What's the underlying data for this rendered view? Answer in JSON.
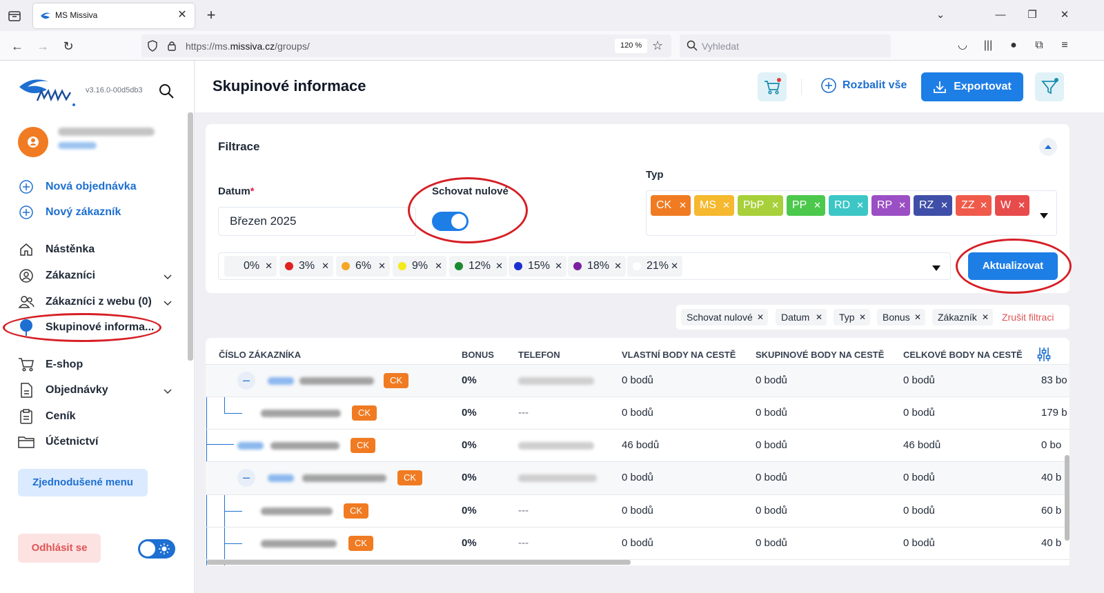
{
  "browser": {
    "tab_title": "MS Missiva",
    "url_prefix": "https://ms.",
    "url_domain": "missiva.cz",
    "url_path": "/groups/",
    "zoom": "120 %",
    "search_placeholder": "Vyhledat"
  },
  "sidebar": {
    "version": "v3.16.0-00d5db3",
    "actions": [
      {
        "label": "Nová objednávka",
        "icon": "plus-circle-icon"
      },
      {
        "label": "Nový zákazník",
        "icon": "plus-circle-icon"
      }
    ],
    "items": [
      {
        "label": "Nástěnka",
        "icon": "home-icon"
      },
      {
        "label": "Zákazníci",
        "icon": "user-circle-icon"
      },
      {
        "label": "Zákazníci z webu (0)",
        "icon": "users-icon"
      },
      {
        "label": "Skupinové informa...",
        "icon": "tree-icon"
      },
      {
        "label": "E-shop",
        "icon": "cart-icon"
      },
      {
        "label": "Objednávky",
        "icon": "document-icon"
      },
      {
        "label": "Ceník",
        "icon": "clipboard-icon"
      },
      {
        "label": "Účetnictví",
        "icon": "folder-icon"
      }
    ],
    "simple_menu": "Zjednodušené menu",
    "logout": "Odhlásit se"
  },
  "header": {
    "title": "Skupinové informace",
    "expand_all": "Rozbalit vše",
    "export": "Exportovat"
  },
  "filters": {
    "title": "Filtrace",
    "date_label": "Datum",
    "date_required": "*",
    "date_value": "Březen 2025",
    "hide_zero_label": "Schovat nulové",
    "hide_zero_on": true,
    "type_label": "Typ",
    "types": [
      {
        "label": "CK",
        "color": "#f07b22"
      },
      {
        "label": "MS",
        "color": "#f5b82e"
      },
      {
        "label": "PbP",
        "color": "#a8d03a"
      },
      {
        "label": "PP",
        "color": "#4cc84c"
      },
      {
        "label": "RD",
        "color": "#3cc6c6"
      },
      {
        "label": "RP",
        "color": "#9b4fc4"
      },
      {
        "label": "RZ",
        "color": "#3f4fa8"
      },
      {
        "label": "ZZ",
        "color": "#f05a4a"
      },
      {
        "label": "W",
        "color": "#e84b4b"
      }
    ],
    "vat_rates": [
      {
        "label": "0%",
        "color": "#f3f4f6"
      },
      {
        "label": "3%",
        "color": "#e02020"
      },
      {
        "label": "6%",
        "color": "#f5a623"
      },
      {
        "label": "9%",
        "color": "#f5e91b"
      },
      {
        "label": "12%",
        "color": "#1b8a2e"
      },
      {
        "label": "15%",
        "color": "#1b2fd1"
      },
      {
        "label": "18%",
        "color": "#7b1fa2"
      },
      {
        "label": "21%",
        "color": "#ffffff"
      }
    ],
    "update_button": "Aktualizovat"
  },
  "active_filters": {
    "chips": [
      "Schovat nulové",
      "Datum",
      "Typ",
      "Bonus",
      "Zákazník"
    ],
    "reset": "Zrušit filtraci"
  },
  "table": {
    "columns": [
      "ČÍSLO ZÁKAZNÍKA",
      "BONUS",
      "TELEFON",
      "VLASTNÍ BODY NA CESTĚ",
      "SKUPINOVÉ BODY NA CESTĚ",
      "CELKOVÉ BODY NA CESTĚ"
    ],
    "rows": [
      {
        "type": "CK",
        "bonus": "0%",
        "phone": "",
        "own": "0 bodů",
        "group": "0 bodů",
        "total": "0 bodů",
        "last": "83 bo"
      },
      {
        "type": "CK",
        "bonus": "0%",
        "phone": "---",
        "own": "0 bodů",
        "group": "0 bodů",
        "total": "0 bodů",
        "last": "179 b"
      },
      {
        "type": "CK",
        "bonus": "0%",
        "phone": "",
        "own": "46 bodů",
        "group": "0 bodů",
        "total": "46 bodů",
        "last": "0 bo"
      },
      {
        "type": "CK",
        "bonus": "0%",
        "phone": "",
        "own": "0 bodů",
        "group": "0 bodů",
        "total": "0 bodů",
        "last": "40 b"
      },
      {
        "type": "CK",
        "bonus": "0%",
        "phone": "---",
        "own": "0 bodů",
        "group": "0 bodů",
        "total": "0 bodů",
        "last": "60 b"
      },
      {
        "type": "CK",
        "bonus": "0%",
        "phone": "---",
        "own": "0 bodů",
        "group": "0 bodů",
        "total": "0 bodů",
        "last": "40 b"
      }
    ]
  }
}
